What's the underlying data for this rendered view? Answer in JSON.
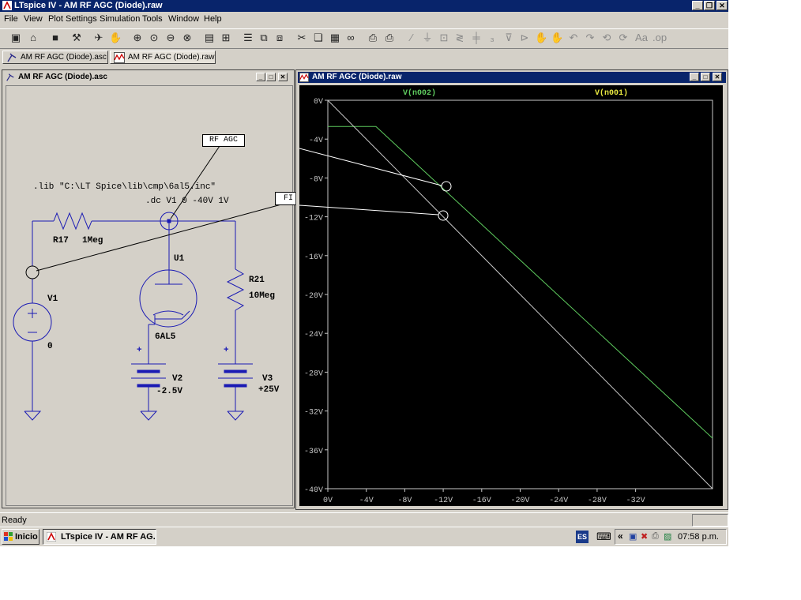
{
  "app": {
    "title": "LTspice IV - AM RF AGC (Diode).raw"
  },
  "menu": [
    "File",
    "View",
    "Plot Settings",
    "Simulation",
    "Tools",
    "Window",
    "Help"
  ],
  "tabs": [
    {
      "label": "AM RF AGC (Diode).asc"
    },
    {
      "label": "AM RF AGC (Diode).raw"
    }
  ],
  "schematic": {
    "title": "AM RF AGC (Diode).asc",
    "lib_directive": ".lib \"C:\\LT Spice\\lib\\cmp\\6al5.inc\"",
    "dc_directive": ".dc V1 0 -40V 1V",
    "callout_rf_agc": "RF AGC",
    "callout_fi_mix_agc": "FI & Mix AGC",
    "r17_name": "R17",
    "r17_value": "1Meg",
    "u1_name": "U1",
    "u1_value": "6AL5",
    "r21_name": "R21",
    "r21_value": "10Meg",
    "v1_name": "V1",
    "v1_value": "0",
    "v2_name": "V2",
    "v2_value": "-2.5V",
    "v3_name": "V3",
    "v3_value": "+25V",
    "plus_sign": "+"
  },
  "waveform": {
    "title": "AM RF AGC (Diode).raw",
    "colors": {
      "v_n002": "#5ecb5e",
      "v_n001": "#e8e840",
      "axis": "#c8c8c8",
      "background": "#000000"
    }
  },
  "chart_data": {
    "type": "line",
    "title": "",
    "xlabel": "",
    "ylabel": "",
    "xlim": [
      0,
      -40
    ],
    "ylim": [
      0,
      -40
    ],
    "x_ticks": [
      "0V",
      "-4V",
      "-8V",
      "-12V",
      "-16V",
      "-20V",
      "-24V",
      "-28V",
      "-32V"
    ],
    "x_tick_values": [
      0,
      -4,
      -8,
      -12,
      -16,
      -20,
      -24,
      -28,
      -32
    ],
    "y_ticks": [
      "0V",
      "-4V",
      "-8V",
      "-12V",
      "-16V",
      "-20V",
      "-24V",
      "-28V",
      "-32V",
      "-36V",
      "-40V"
    ],
    "y_tick_values": [
      0,
      -4,
      -8,
      -12,
      -16,
      -20,
      -24,
      -28,
      -32,
      -36,
      -40
    ],
    "series": [
      {
        "name": "V(n002)",
        "x": [
          0,
          -5,
          -40
        ],
        "y": [
          -2.7,
          -2.7,
          -34.8
        ]
      },
      {
        "name": "V(n001)",
        "x": [
          0,
          -40
        ],
        "y": [
          0,
          -40
        ]
      }
    ],
    "grid": false,
    "legend": "top"
  },
  "status": {
    "text": "Ready"
  },
  "taskbar": {
    "start_label": "Inicio",
    "task_label": "LTspice IV - AM RF AG...",
    "lang": "ES",
    "tray_chevron": "«",
    "clock": "07:58 p.m."
  }
}
